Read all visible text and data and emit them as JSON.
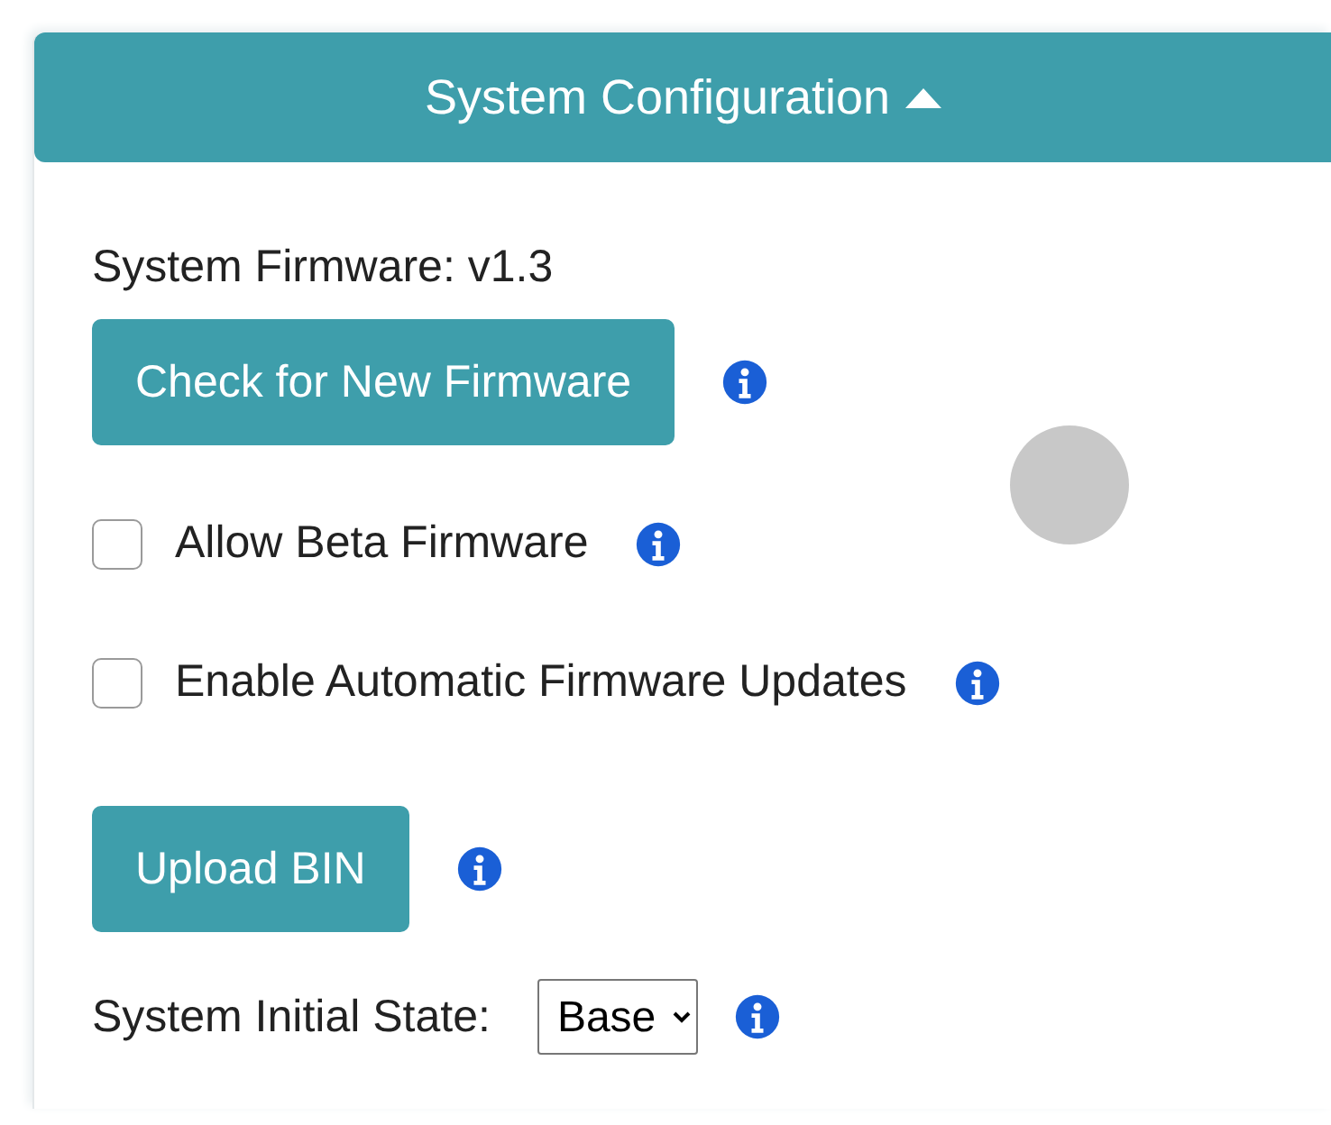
{
  "panel": {
    "title": "System Configuration",
    "expanded": true
  },
  "items": [
    {
      "kind": "text",
      "label": "System Firmware: v1.3"
    },
    {
      "kind": "button",
      "label": "Check for New Firmware",
      "info": true
    },
    {
      "kind": "checkbox",
      "label": "Allow Beta Firmware",
      "checked": false,
      "info": true
    },
    {
      "kind": "checkbox",
      "label": "Enable Automatic Firmware Updates",
      "checked": false,
      "info": true
    },
    {
      "kind": "button",
      "label": "Upload BIN",
      "info": true
    },
    {
      "kind": "select",
      "label": "System Initial State:",
      "value": "Base",
      "info": true
    }
  ]
}
